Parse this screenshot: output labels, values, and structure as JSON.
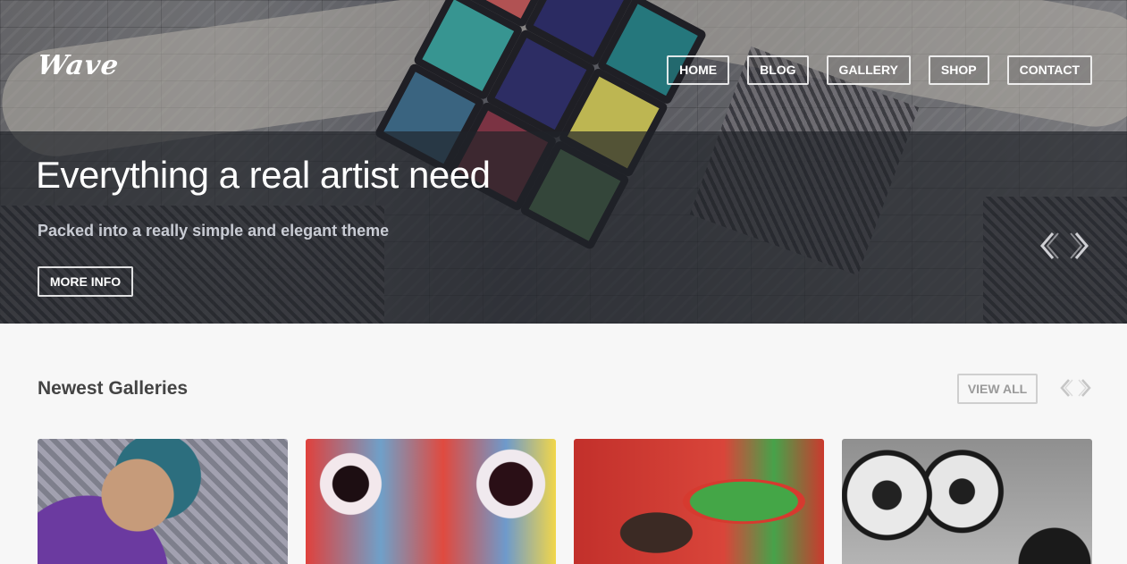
{
  "brand": {
    "logo_text": "Wave"
  },
  "nav": {
    "items": [
      {
        "label": "HOME"
      },
      {
        "label": "BLOG"
      },
      {
        "label": "GALLERY"
      },
      {
        "label": "SHOP"
      },
      {
        "label": "CONTACT"
      }
    ]
  },
  "hero": {
    "title": "Everything a real artist need",
    "subtitle": "Packed into a really simple and elegant theme",
    "button_label": "MORE INFO",
    "prev_icon": "chevron-left-icon",
    "next_icon": "chevron-right-icon"
  },
  "galleries": {
    "title": "Newest Galleries",
    "view_all_label": "VIEW ALL",
    "prev_icon": "chevron-left-icon",
    "next_icon": "chevron-right-icon"
  },
  "colors": {
    "page_background": "#f7f7f7",
    "hero_band": "#202228",
    "text_dark": "#444444",
    "muted_button": "#9a9a9a"
  }
}
